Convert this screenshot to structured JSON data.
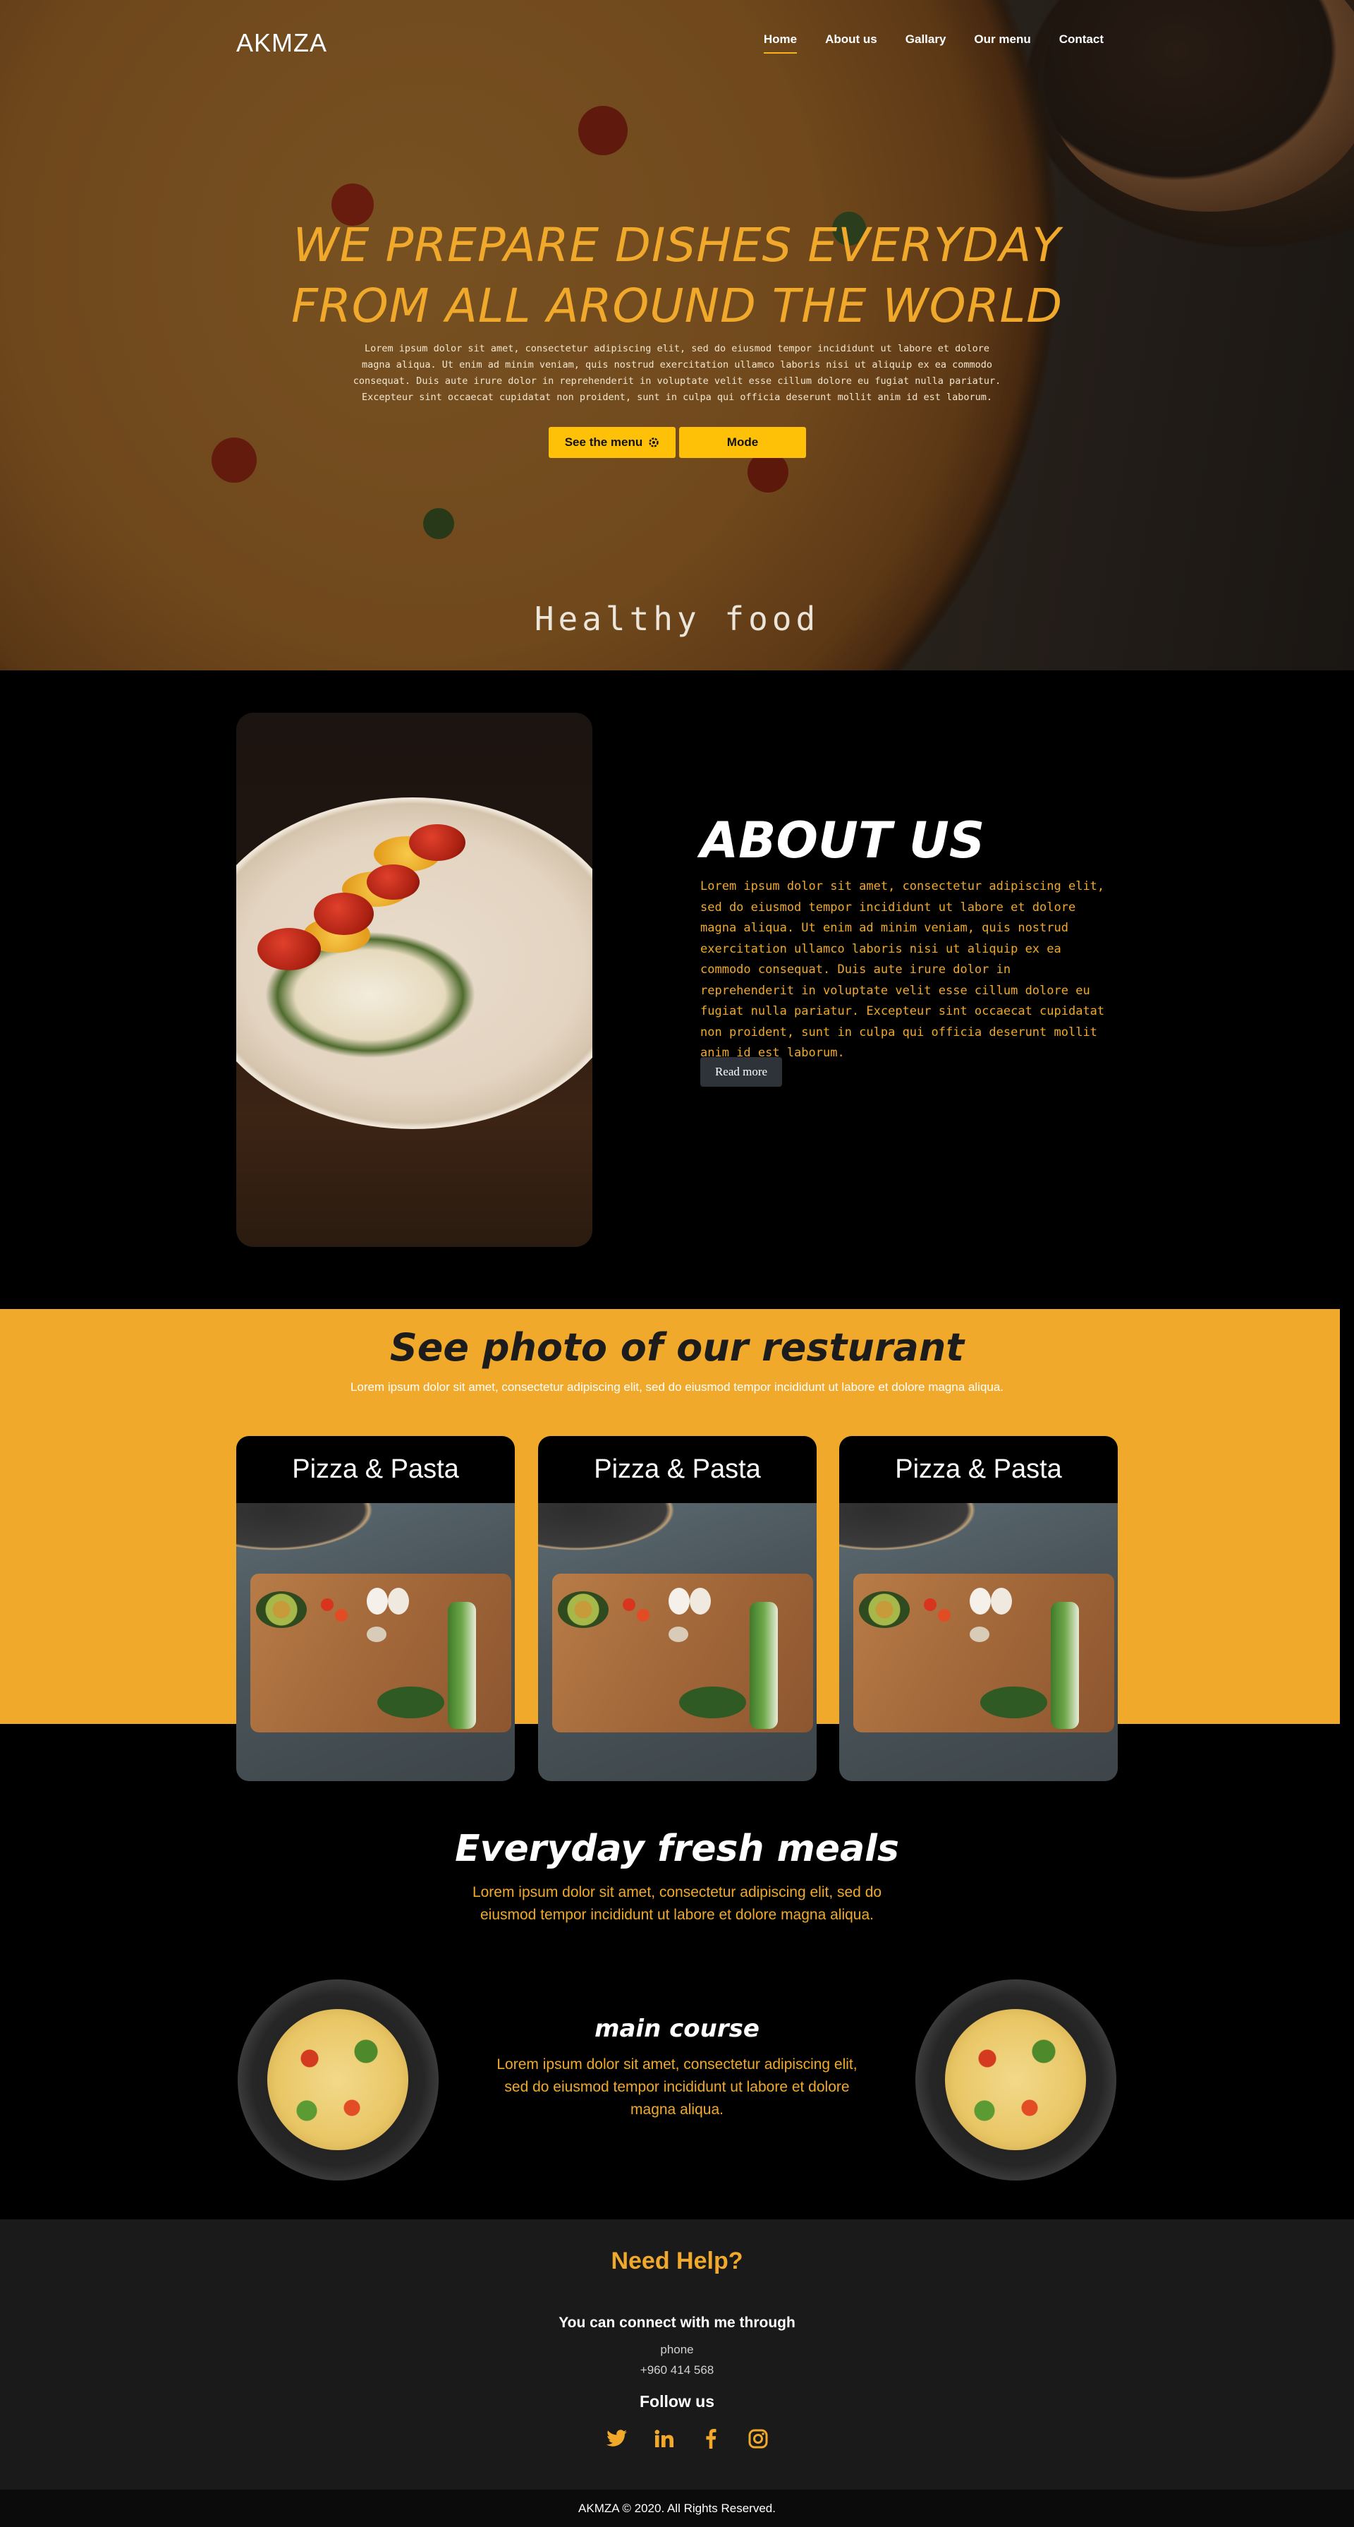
{
  "brand": "AKMZA",
  "nav": {
    "items": [
      {
        "label": "Home",
        "active": true
      },
      {
        "label": "About us",
        "active": false
      },
      {
        "label": "Gallary",
        "active": false
      },
      {
        "label": "Our menu",
        "active": false
      },
      {
        "label": "Contact",
        "active": false
      }
    ]
  },
  "hero": {
    "title_line1": "WE PREPARE DISHES EVERYDAY",
    "title_line2": "FROM ALL AROUND THE WORLD",
    "text": "Lorem ipsum dolor sit amet, consectetur adipiscing elit, sed do eiusmod tempor incididunt ut labore et dolore magna aliqua. Ut enim ad minim veniam, quis nostrud exercitation ullamco laboris nisi ut aliquip ex ea commodo consequat. Duis aute irure dolor in reprehenderit in voluptate velit esse cillum dolore eu fugiat nulla pariatur. Excepteur sint occaecat cupidatat non proident, sunt in culpa qui officia deserunt mollit anim id est laborum.",
    "menu_button": "See the menu",
    "mode_button": "Mode",
    "tagline": "Healthy food"
  },
  "about": {
    "title": "ABOUT US",
    "text": "Lorem ipsum dolor sit amet, consectetur adipiscing elit, sed do eiusmod tempor incididunt ut labore et dolore magna aliqua. Ut enim ad minim veniam, quis nostrud exercitation ullamco laboris nisi ut aliquip ex ea commodo consequat. Duis aute irure dolor in reprehenderit in voluptate velit esse cillum dolore eu fugiat nulla pariatur. Excepteur sint occaecat cupidatat non proident, sunt in culpa qui officia deserunt mollit anim id est laborum.",
    "read_more": "Read more"
  },
  "gallery": {
    "title": "See photo of our resturant",
    "subtitle": "Lorem ipsum dolor sit amet, consectetur adipiscing elit, sed do eiusmod tempor incididunt ut labore et dolore magna aliqua.",
    "cards": [
      {
        "title": "Pizza & Pasta"
      },
      {
        "title": "Pizza & Pasta"
      },
      {
        "title": "Pizza & Pasta"
      }
    ]
  },
  "meals": {
    "title": "Everyday fresh meals",
    "subtitle": "Lorem ipsum dolor sit amet, consectetur adipiscing elit, sed do eiusmod tempor incididunt ut labore et dolore magna aliqua.",
    "course_title": "main course",
    "course_text": "Lorem ipsum dolor sit amet, consectetur adipiscing elit, sed do eiusmod tempor incididunt ut labore et dolore magna aliqua."
  },
  "footer": {
    "help": "Need Help?",
    "connect": "You can connect with me through",
    "phone_label": "phone",
    "phone": "+960 414 568",
    "follow": "Follow us",
    "socials": [
      "twitter-icon",
      "linkedin-icon",
      "facebook-icon",
      "instagram-icon"
    ],
    "copyright": "AKMZA © 2020. All Rights Reserved."
  },
  "colors": {
    "accent": "#f0a92b",
    "button_yellow": "#ffc107",
    "dark": "#1a1a1a"
  }
}
